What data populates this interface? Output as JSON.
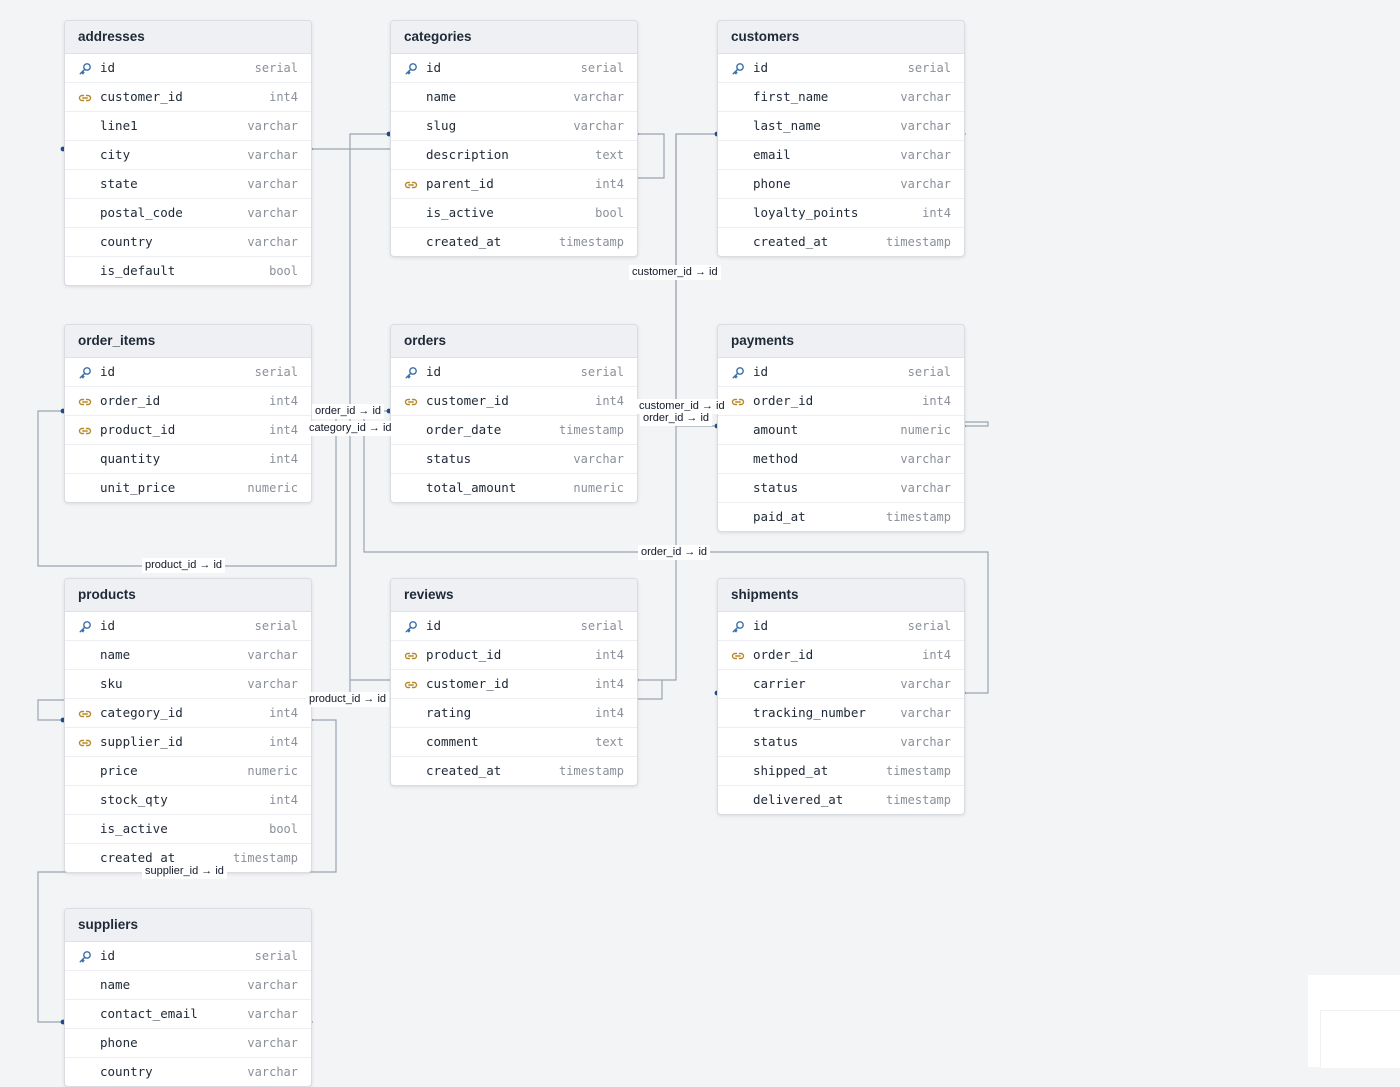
{
  "colors": {
    "background": "#f3f4f6",
    "pk_icon": "#3b6ea8",
    "fk_icon": "#b5892a",
    "edge": "#9ca3af",
    "handle": "#1f4e8c"
  },
  "tables": [
    {
      "id": "addresses",
      "name": "addresses",
      "columns": [
        {
          "name": "id",
          "type": "serial",
          "key": "pk"
        },
        {
          "name": "customer_id",
          "type": "int4",
          "key": "fk"
        },
        {
          "name": "line1",
          "type": "varchar",
          "key": ""
        },
        {
          "name": "city",
          "type": "varchar",
          "key": ""
        },
        {
          "name": "state",
          "type": "varchar",
          "key": ""
        },
        {
          "name": "postal_code",
          "type": "varchar",
          "key": ""
        },
        {
          "name": "country",
          "type": "varchar",
          "key": ""
        },
        {
          "name": "is_default",
          "type": "bool",
          "key": ""
        }
      ]
    },
    {
      "id": "categories",
      "name": "categories",
      "columns": [
        {
          "name": "id",
          "type": "serial",
          "key": "pk"
        },
        {
          "name": "name",
          "type": "varchar",
          "key": ""
        },
        {
          "name": "slug",
          "type": "varchar",
          "key": ""
        },
        {
          "name": "description",
          "type": "text",
          "key": ""
        },
        {
          "name": "parent_id",
          "type": "int4",
          "key": "fk"
        },
        {
          "name": "is_active",
          "type": "bool",
          "key": ""
        },
        {
          "name": "created_at",
          "type": "timestamp",
          "key": ""
        }
      ]
    },
    {
      "id": "customers",
      "name": "customers",
      "columns": [
        {
          "name": "id",
          "type": "serial",
          "key": "pk"
        },
        {
          "name": "first_name",
          "type": "varchar",
          "key": ""
        },
        {
          "name": "last_name",
          "type": "varchar",
          "key": ""
        },
        {
          "name": "email",
          "type": "varchar",
          "key": ""
        },
        {
          "name": "phone",
          "type": "varchar",
          "key": ""
        },
        {
          "name": "loyalty_points",
          "type": "int4",
          "key": ""
        },
        {
          "name": "created_at",
          "type": "timestamp",
          "key": ""
        }
      ]
    },
    {
      "id": "order_items",
      "name": "order_items",
      "columns": [
        {
          "name": "id",
          "type": "serial",
          "key": "pk"
        },
        {
          "name": "order_id",
          "type": "int4",
          "key": "fk"
        },
        {
          "name": "product_id",
          "type": "int4",
          "key": "fk"
        },
        {
          "name": "quantity",
          "type": "int4",
          "key": ""
        },
        {
          "name": "unit_price",
          "type": "numeric",
          "key": ""
        }
      ]
    },
    {
      "id": "orders",
      "name": "orders",
      "columns": [
        {
          "name": "id",
          "type": "serial",
          "key": "pk"
        },
        {
          "name": "customer_id",
          "type": "int4",
          "key": "fk"
        },
        {
          "name": "order_date",
          "type": "timestamp",
          "key": ""
        },
        {
          "name": "status",
          "type": "varchar",
          "key": ""
        },
        {
          "name": "total_amount",
          "type": "numeric",
          "key": ""
        }
      ]
    },
    {
      "id": "payments",
      "name": "payments",
      "columns": [
        {
          "name": "id",
          "type": "serial",
          "key": "pk"
        },
        {
          "name": "order_id",
          "type": "int4",
          "key": "fk"
        },
        {
          "name": "amount",
          "type": "numeric",
          "key": ""
        },
        {
          "name": "method",
          "type": "varchar",
          "key": ""
        },
        {
          "name": "status",
          "type": "varchar",
          "key": ""
        },
        {
          "name": "paid_at",
          "type": "timestamp",
          "key": ""
        }
      ]
    },
    {
      "id": "products",
      "name": "products",
      "columns": [
        {
          "name": "id",
          "type": "serial",
          "key": "pk"
        },
        {
          "name": "name",
          "type": "varchar",
          "key": ""
        },
        {
          "name": "sku",
          "type": "varchar",
          "key": ""
        },
        {
          "name": "category_id",
          "type": "int4",
          "key": "fk"
        },
        {
          "name": "supplier_id",
          "type": "int4",
          "key": "fk"
        },
        {
          "name": "price",
          "type": "numeric",
          "key": ""
        },
        {
          "name": "stock_qty",
          "type": "int4",
          "key": ""
        },
        {
          "name": "is_active",
          "type": "bool",
          "key": ""
        },
        {
          "name": "created_at",
          "type": "timestamp",
          "key": ""
        }
      ]
    },
    {
      "id": "reviews",
      "name": "reviews",
      "columns": [
        {
          "name": "id",
          "type": "serial",
          "key": "pk"
        },
        {
          "name": "product_id",
          "type": "int4",
          "key": "fk"
        },
        {
          "name": "customer_id",
          "type": "int4",
          "key": "fk"
        },
        {
          "name": "rating",
          "type": "int4",
          "key": ""
        },
        {
          "name": "comment",
          "type": "text",
          "key": ""
        },
        {
          "name": "created_at",
          "type": "timestamp",
          "key": ""
        }
      ]
    },
    {
      "id": "shipments",
      "name": "shipments",
      "columns": [
        {
          "name": "id",
          "type": "serial",
          "key": "pk"
        },
        {
          "name": "order_id",
          "type": "int4",
          "key": "fk"
        },
        {
          "name": "carrier",
          "type": "varchar",
          "key": ""
        },
        {
          "name": "tracking_number",
          "type": "varchar",
          "key": ""
        },
        {
          "name": "status",
          "type": "varchar",
          "key": ""
        },
        {
          "name": "shipped_at",
          "type": "timestamp",
          "key": ""
        },
        {
          "name": "delivered_at",
          "type": "timestamp",
          "key": ""
        }
      ]
    },
    {
      "id": "suppliers",
      "name": "suppliers",
      "columns": [
        {
          "name": "id",
          "type": "serial",
          "key": "pk"
        },
        {
          "name": "name",
          "type": "varchar",
          "key": ""
        },
        {
          "name": "contact_email",
          "type": "varchar",
          "key": ""
        },
        {
          "name": "phone",
          "type": "varchar",
          "key": ""
        },
        {
          "name": "country",
          "type": "varchar",
          "key": ""
        }
      ]
    }
  ],
  "relationships": [
    {
      "from_table": "addresses",
      "from_column": "customer_id",
      "to_table": "customers",
      "to_column": "id",
      "label": ""
    },
    {
      "from_table": "categories",
      "from_column": "parent_id",
      "to_table": "categories",
      "to_column": "id",
      "label": ""
    },
    {
      "from_table": "reviews",
      "from_column": "customer_id",
      "to_table": "customers",
      "to_column": "id",
      "label": "customer_id → id"
    },
    {
      "from_table": "orders",
      "from_column": "customer_id",
      "to_table": "customers",
      "to_column": "id",
      "label": "customer_id → id"
    },
    {
      "from_table": "order_items",
      "from_column": "order_id",
      "to_table": "orders",
      "to_column": "id",
      "label": "order_id → id"
    },
    {
      "from_table": "payments",
      "from_column": "order_id",
      "to_table": "orders",
      "to_column": "id",
      "label": "order_id → id"
    },
    {
      "from_table": "order_items",
      "from_column": "product_id",
      "to_table": "products",
      "to_column": "id",
      "label": "product_id → id"
    },
    {
      "from_table": "products",
      "from_column": "category_id",
      "to_table": "categories",
      "to_column": "id",
      "label": "category_id → id"
    },
    {
      "from_table": "shipments",
      "from_column": "order_id",
      "to_table": "orders",
      "to_column": "id",
      "label": "order_id → id"
    },
    {
      "from_table": "reviews",
      "from_column": "product_id",
      "to_table": "products",
      "to_column": "id",
      "label": "product_id → id"
    },
    {
      "from_table": "products",
      "from_column": "supplier_id",
      "to_table": "suppliers",
      "to_column": "id",
      "label": "supplier_id → id"
    }
  ]
}
